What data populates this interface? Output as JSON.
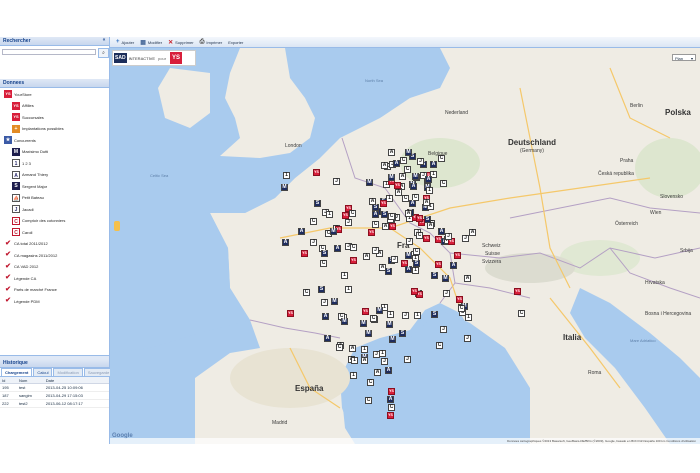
{
  "left_panel": {
    "search_title": "Rechercher",
    "search_placeholder": "",
    "data_title": "Donnees",
    "tree": [
      {
        "label": "YourStore",
        "icon": "ys-icon",
        "level": 0
      },
      {
        "label": "Affilies",
        "icon": "ys-icon",
        "level": 1
      },
      {
        "label": "Succursales",
        "icon": "ys-icon",
        "level": 1
      },
      {
        "label": "Implantations possibles",
        "icon": "plus-icon",
        "level": 1
      },
      {
        "label": "Concurrents",
        "icon": "star-icon",
        "level": 0
      },
      {
        "label": "Maxisimo Dutti",
        "icon": "m-icon",
        "level": 1
      },
      {
        "label": "1 2 3",
        "icon": "number-icon",
        "level": 1
      },
      {
        "label": "Armand Thiery",
        "icon": "a-icon",
        "level": 1
      },
      {
        "label": "Sergent Major",
        "icon": "s-icon",
        "level": 1
      },
      {
        "label": "Petit Bateau",
        "icon": "boat-icon",
        "level": 1
      },
      {
        "label": "Jacadi",
        "icon": "j-icon",
        "level": 1
      },
      {
        "label": "Comptoir des cotonniers",
        "icon": "c-icon",
        "level": 1
      },
      {
        "label": "Caroll",
        "icon": "c-icon",
        "level": 1
      },
      {
        "label": "CA total 2011/2012",
        "icon": "check-icon",
        "level": 0
      },
      {
        "label": "CA magasins 2011/2012",
        "icon": "check-icon",
        "level": 0
      },
      {
        "label": "CA VAD 2012",
        "icon": "check-icon",
        "level": 0
      },
      {
        "label": "Légende CA",
        "icon": "check-icon",
        "level": 0
      },
      {
        "label": "Parts de marché France",
        "icon": "check-icon",
        "level": 0
      },
      {
        "label": "Légende PDM",
        "icon": "check-icon",
        "level": 0
      }
    ],
    "history_title": "Historique",
    "history_tabs": [
      "Chargement",
      "Calcul",
      "Modification",
      "Sauvegarde"
    ],
    "history_columns": [
      "Id",
      "Nom",
      "Date"
    ],
    "history_rows": [
      {
        "id": "195",
        "name": "test",
        "date": "2013-04-25 10:09:06"
      },
      {
        "id": "187",
        "name": "sangim",
        "date": "2013-04-29 17:15:03"
      },
      {
        "id": "222",
        "name": "test2",
        "date": "2013-06-12 08:17:17"
      }
    ]
  },
  "toolbar": {
    "add_label": "Ajouter",
    "edit_label": "Modifier",
    "delete_label": "Supprimer",
    "print_label": "Imprimer",
    "export_label": "Exporter"
  },
  "map": {
    "brand_sad": "SAD",
    "brand_interactive": "INTERACTIVE",
    "brand_pour": "pour",
    "brand_ys": "YS",
    "map_type": "Plan",
    "copyright": "Données cartographiques ©2013 Basarsoft, GeoBasis-DE/BKG (©2009), Google, basado en BCN IGN España   100 km   Conditions d'utilisation",
    "google": "Google",
    "labels": {
      "deutschland": "Deutschland",
      "germany": "(Germany)",
      "france": "Fra",
      "italia": "Italia",
      "espana": "España",
      "belgique": "Belgique",
      "nederland": "Nederland",
      "schweiz": "Schweiz",
      "suisse": "Suisse",
      "svizzera": "Svizzera",
      "ceska": "Česká republika",
      "osterreich": "Österreich",
      "slovensko": "Slovensko",
      "hrvatska": "Hrvatska",
      "bosnia": "Bosna i Hercegovina",
      "srbija": "Srbija",
      "london": "London",
      "paris": "Paris",
      "berlin": "Berlin",
      "roma": "Roma",
      "madrid": "Madrid",
      "wien": "Wien",
      "praha": "Praha",
      "polska": "Polska",
      "mare": "Mare Adriatico",
      "celtic": "Celtic Sea",
      "north": "North Sea"
    }
  }
}
